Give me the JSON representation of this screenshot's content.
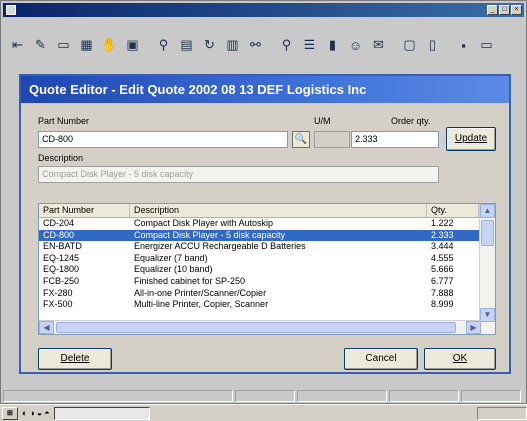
{
  "dialog": {
    "title": "Quote Editor - Edit Quote 2002 08 13 DEF Logistics Inc",
    "part_number_label": "Part Number",
    "part_number_value": "CD-800",
    "um_label": "U/M",
    "um_value": "",
    "order_qty_label": "Order qty.",
    "order_qty_value": "2.333",
    "update_label": "Update",
    "description_label": "Description",
    "description_value": "Compact Disk Player - 5 disk capacity",
    "list": {
      "columns": [
        "Part Number",
        "Description",
        "Qty."
      ],
      "selected_index": 1,
      "rows": [
        {
          "part": "CD-204",
          "desc": "Compact Disk Player with Autoskip",
          "qty": "1.222"
        },
        {
          "part": "CD-800",
          "desc": "Compact Disk Player - 5 disk capacity",
          "qty": "2.333"
        },
        {
          "part": "EN-BATD",
          "desc": "Energizer ACCU Rechargeable D Batteries",
          "qty": "3.444"
        },
        {
          "part": "EQ-1245",
          "desc": "Equalizer (7 band)",
          "qty": "4.555"
        },
        {
          "part": "EQ-1800",
          "desc": "Equalizer (10 band)",
          "qty": "5.666"
        },
        {
          "part": "FCB-250",
          "desc": "Finished cabinet for SP-250",
          "qty": "6.777"
        },
        {
          "part": "FX-280",
          "desc": "All-in-one Printer/Scanner/Copier",
          "qty": "7.888"
        },
        {
          "part": "FX-500",
          "desc": "Multi-line Printer, Copier, Scanner",
          "qty": "8.999"
        }
      ]
    },
    "delete_label": "Delete",
    "cancel_label": "Cancel",
    "ok_label": "OK"
  },
  "colors": {
    "dialog_title_bg": "#1f46b4",
    "selection": "#316ac5"
  }
}
